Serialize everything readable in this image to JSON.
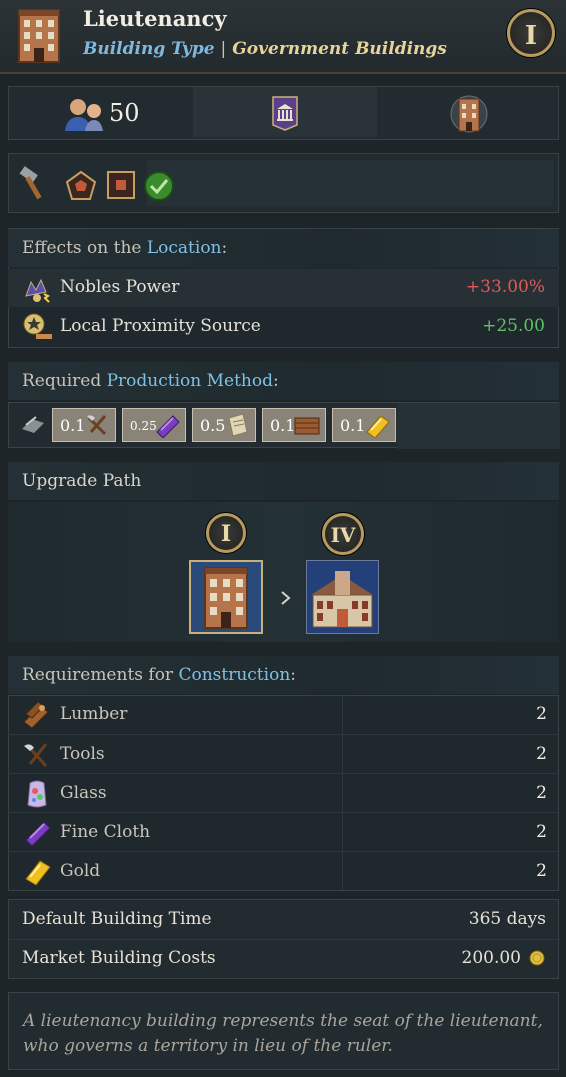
{
  "header": {
    "title": "Lieutenancy",
    "building_type_label": "Building Type",
    "separator": "|",
    "category": "Government Buildings",
    "tier": "I"
  },
  "stats": {
    "population": "50"
  },
  "effects": {
    "heading_prefix": "Effects on the ",
    "heading_link": "Location",
    "heading_suffix": ":",
    "rows": [
      {
        "label": "Nobles Power",
        "value": "+33.00%",
        "icon": "nobles-power-icon"
      },
      {
        "label": "Local Proximity Source",
        "value": "+25.00",
        "icon": "proximity-source-icon"
      }
    ]
  },
  "production": {
    "heading_prefix": "Required ",
    "heading_link": "Production Method",
    "heading_suffix": ":",
    "inputs": [
      {
        "amount": "0.1",
        "icon": "tools-icon"
      },
      {
        "amount": "0.25",
        "icon": "fine-cloth-icon"
      },
      {
        "amount": "0.5",
        "icon": "paper-icon"
      },
      {
        "amount": "0.1",
        "icon": "lumber-icon"
      },
      {
        "amount": "0.1",
        "icon": "gold-icon"
      }
    ]
  },
  "upgrade": {
    "heading": "Upgrade Path",
    "from_tier": "I",
    "to_tier": "IV"
  },
  "construction": {
    "heading_prefix": "Requirements for ",
    "heading_link": "Construction",
    "heading_suffix": ":",
    "items": [
      {
        "label": "Lumber",
        "value": "2"
      },
      {
        "label": "Tools",
        "value": "2"
      },
      {
        "label": "Glass",
        "value": "2"
      },
      {
        "label": "Fine Cloth",
        "value": "2"
      },
      {
        "label": "Gold",
        "value": "2"
      }
    ]
  },
  "costs": {
    "time_label": "Default Building Time",
    "time_value": "365 days",
    "market_label": "Market Building Costs",
    "market_value": "200.00"
  },
  "description": "A lieutenancy building represents the seat of the lieutenant, who governs a territory in lieu of the ruler.",
  "colors": {
    "accent": "#7fc1e6",
    "negative": "#e05a5a",
    "positive": "#5fc266",
    "gold": "#e8d49a"
  }
}
